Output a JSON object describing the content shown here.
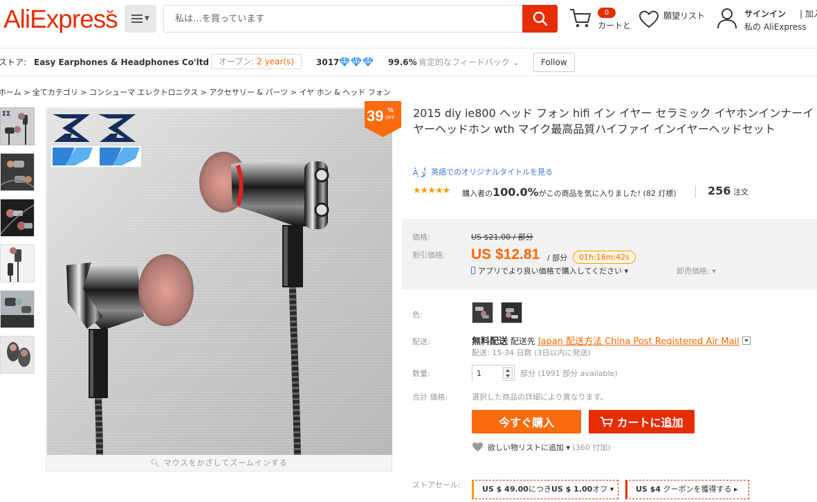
{
  "header": {
    "logo": "AliExpress",
    "search_placeholder": "私は…を買っています",
    "cart_count": "0",
    "cart_label": "カートと",
    "wishlist_label": "願望リスト",
    "signin_label": "サインイン",
    "join_label": "| 加入",
    "account_label": "私の AliExpress",
    "colors": {
      "brand": "#e62e04",
      "accent": "#f60"
    }
  },
  "store": {
    "label": "ストア:",
    "name": "Easy Earphones & Headphones Co'ltd",
    "open_prefix": "オープン:",
    "open_years": "2 year(s)",
    "score": "3017",
    "feedback_pct": "99.6%",
    "feedback_label": "肯定的なフィードバック",
    "follow_label": "Follow"
  },
  "breadcrumb": "ホーム > 全てカテゴリ > コンシューマ エレクトロニクス > アクセサリー & パーツ > イヤ ホン & ヘッド フォン",
  "product": {
    "title": "2015 diy ie800 ヘッド フォン hifi イン イヤー セラミック イヤホンインナーイヤーヘッドホン wth マイク最高品質ハイファイ インイヤーヘッドセット",
    "translate_link": "英語でのオリジナルタイトルを見る",
    "rating_stars": "★★★★★",
    "rating_prefix": "購入者の",
    "rating_pct": "100.0%",
    "rating_suffix": "がこの商品を気に入りました! (82 灯標)",
    "orders_count": "256",
    "orders_label": "注文",
    "discount_value": "39",
    "discount_pct": "%",
    "discount_off": "OFF",
    "zoom_hint": "マウスをかざしてズームインする"
  },
  "price": {
    "orig_label": "価格:",
    "orig_value": "US $21.00 / 部分",
    "sale_label": "割引価格:",
    "sale_value": "US $12.81",
    "sale_unit": "/ 部分",
    "timer": "01h:18m:42s",
    "app_price": "アプリでより良い価格で購入してください ▾",
    "wholesale": "卸売価格: ▾"
  },
  "options": {
    "color_label": "色:",
    "shipping_label": "配送:",
    "free_shipping": "無料配送",
    "ship_to": "配送先",
    "ship_method": "Japan 配送方法 China Post Registered Air Mail",
    "ship_time": "配送: 15-34 日数 (3日以内に発送)",
    "qty_label": "数量:",
    "qty_value": "1",
    "qty_avail": "部分 (1991 部分 available)",
    "total_label": "合計 価格:",
    "total_note": "選択した商品の詳細により異なります。",
    "buy_now": "今すぐ購入",
    "add_to_cart": "カートに追加",
    "wishlist_add": "欲しい物リストに追加 ▾",
    "wishlist_count": "(360 付加)",
    "store_sale_label": "ストアセール:",
    "coupon1_a": "US $ 49.00",
    "coupon1_b": "につき",
    "coupon1_c": "US $ 1.00",
    "coupon1_d": "オフ ▾",
    "coupon2_a": "US $4",
    "coupon2_b": "クーポンを獲得する ▸"
  }
}
